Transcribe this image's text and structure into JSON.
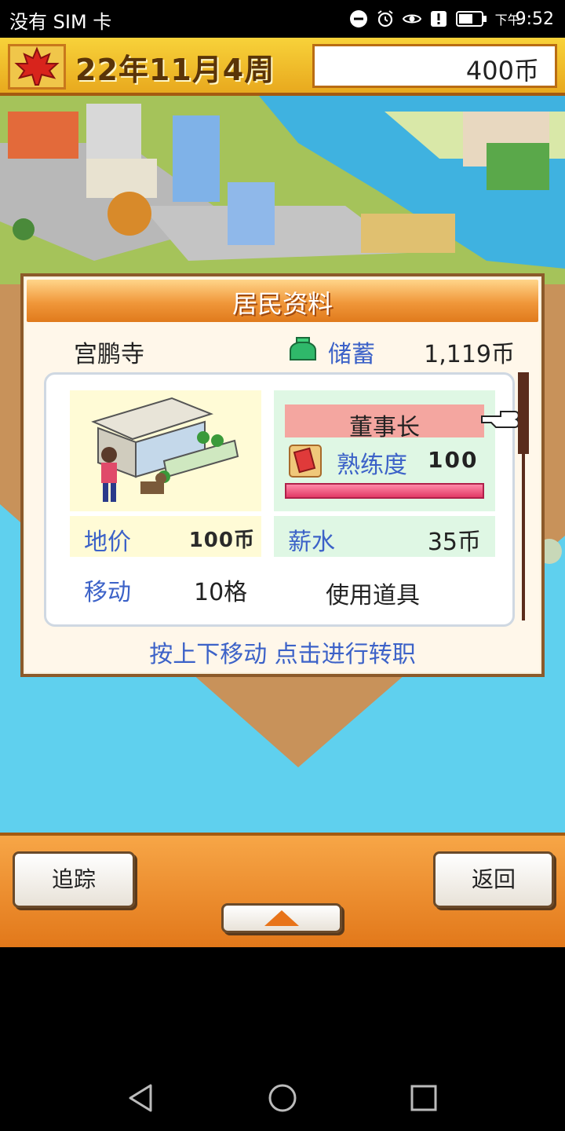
{
  "status_bar": {
    "carrier": "没有 SIM 卡",
    "time_prefix": "下午",
    "time": "9:52"
  },
  "top_bar": {
    "date": "22年11月4周",
    "money": "400币"
  },
  "dialog": {
    "title": "居民资料",
    "resident_name": "宫鹏寺",
    "savings_label": "储蓄",
    "savings_value": "1,119币",
    "land_price_label": "地价",
    "land_price_value": "100币",
    "job_title": "董事长",
    "skill_label": "熟练度",
    "skill_value": "100",
    "skill_level": 1.0,
    "salary_label": "薪水",
    "salary_value": "35币",
    "move_label": "移动",
    "move_value": "10格",
    "use_item_label": "使用道具",
    "hint": "按上下移动 点击进行转职"
  },
  "bottom_bar": {
    "track_label": "追踪",
    "back_label": "返回"
  },
  "colors": {
    "accent_blue": "#3c62c8",
    "title_orange": "#e07a1c",
    "bar_gold": "#f8d23a",
    "water": "#5fd0ee"
  }
}
